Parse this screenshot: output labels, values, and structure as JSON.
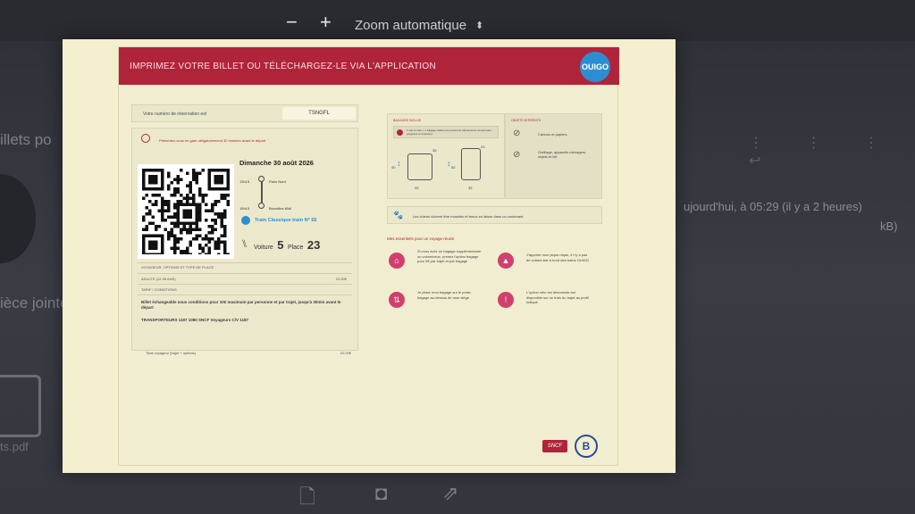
{
  "toolbar": {
    "zoom_out": "−",
    "zoom_in": "+",
    "zoom_value": "Zoom automatique",
    "zoom_chevron": "⬍"
  },
  "background": {
    "left_text_1": "illets po",
    "left_text_2": "ièce jointe",
    "right_text_1": "ujourd'hui, à 05:29 (il y a 2 heures)",
    "right_text_2": "kB)",
    "file_label": "ts.pdf"
  },
  "ticket": {
    "banner_title": "IMPRIMEZ VOTRE BILLET OU TÉLÉCHARGEZ-LE VIA L'APPLICATION",
    "brand_logo": "OUIGO",
    "reservation_label": "Votre numéro de réservation est",
    "reservation_code": "TSNGFL",
    "warning_text": "Présentez-vous en gare obligatoirement 30 minutes avant le départ",
    "date": "Dimanche 30 août 2026",
    "departure_time": "13h15",
    "departure_station": "Paris Nord",
    "arrival_time": "15h15",
    "arrival_station": "Bruxelles Midi",
    "train_name": "Train Classique train N° 65",
    "coach_label": "Voiture",
    "coach_number": "5",
    "seat_label": "Place",
    "seat_number": "23",
    "passenger_header": "VOYAGEUR, OPTIONS ET TYPE DE PLACE",
    "passenger_line": "ADULTE (12-59 ANS)",
    "passenger_price": "22,00€",
    "conditions_header": "TARIF / CONDITIONS",
    "conditions_text": "Billet échangeable sous conditions pour 10€ maximum par personne et par trajet, jusqu'à 30min avant le départ",
    "carrier_text": "TRANSPORTEURS 1187 1080 SNCF Voyageurs C/V 1187",
    "total_label": "Total voyageur (trajet + options)",
    "total_value": "22,00€"
  },
  "baggage": {
    "allowed_title": "BAGAGES INCLUS",
    "allowed_text": "1 sac à main + 1 bagage cabine par personne (dimensions comprenant poignées et roulettes)",
    "dims_w": "35",
    "dims_h": "40",
    "dims_d": "55",
    "dims_d2": "23",
    "forbidden_title": "OBJETS INTERDITS",
    "forbidden_1": "Cartons et papiers",
    "forbidden_2": "Outillage, appareils ménagers, objets et hifi",
    "dogs_text": "Les chiens doivent être muselés et tenus en laisse dans un contenant"
  },
  "essentials": {
    "title": "Mes essentiels pour un voyage réussi",
    "items": [
      {
        "icon": "bag-icon",
        "text": "Si vous avez un bagage supplémentaire ou volumineux, prenez l'option bagage pour 5€ par trajet et par bagage"
      },
      {
        "icon": "warning-icon",
        "text": "J'apporte mon pique-nique, il n'y a pas de voiture-bar à bord des trains OUIGO"
      },
      {
        "icon": "luggage-tag-icon",
        "text": "Je place mon bagage sur le porte-bagage au-dessus de mon siège"
      },
      {
        "icon": "alert-icon",
        "text": "L'option vélo est désormais est disponible sur ce train du trajet au profil indiqué"
      }
    ]
  },
  "footer": {
    "sncf_logo": "SNCF",
    "sncb_logo": "B"
  }
}
